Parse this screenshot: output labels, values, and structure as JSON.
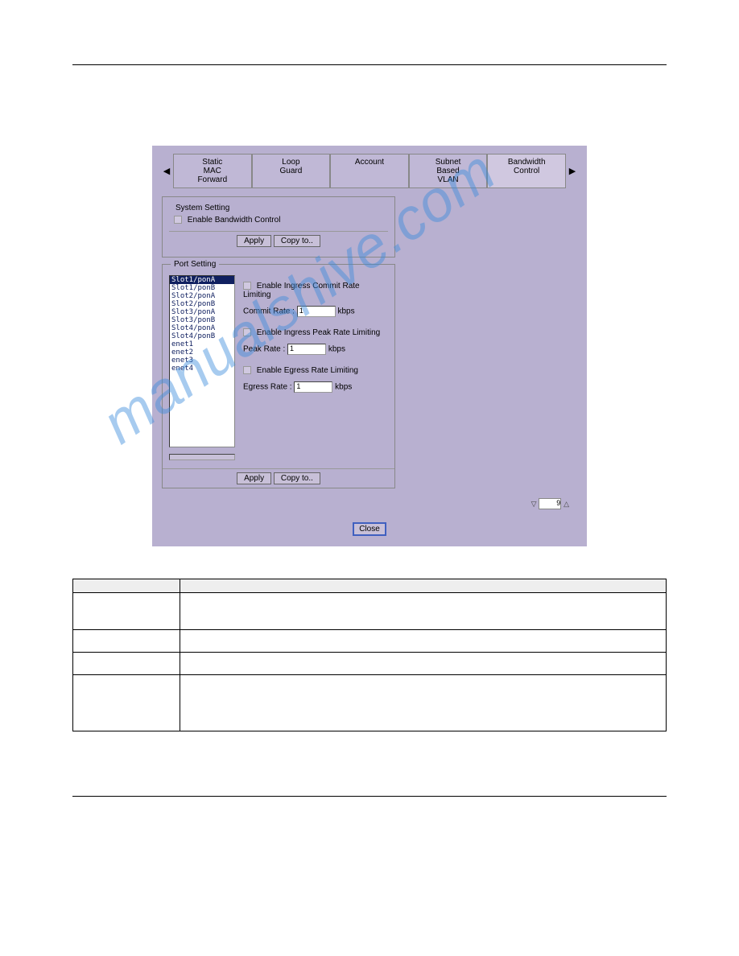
{
  "tabs": {
    "t1": "Static\nMAC\nForward",
    "t2": "Loop\nGuard",
    "t3": "Account",
    "t4": "Subnet\nBased\nVLAN",
    "t5": "Bandwidth\nControl"
  },
  "system": {
    "legend": "System Setting",
    "enable": "Enable Bandwidth Control",
    "apply": "Apply",
    "copy": "Copy to.."
  },
  "port": {
    "legend": "Port Setting",
    "items": {
      "i0": "Slot1/ponA",
      "i1": "Slot1/ponB",
      "i2": "Slot2/ponA",
      "i3": "Slot2/ponB",
      "i4": "Slot3/ponA",
      "i5": "Slot3/ponB",
      "i6": "Slot4/ponA",
      "i7": "Slot4/ponB",
      "i8": "enet1",
      "i9": "enet2",
      "i10": "enet3",
      "i11": "enet4"
    },
    "ingress_commit_chk": "Enable Ingress Commit Rate Limiting",
    "commit_label": "Commit Rate :",
    "commit_val": "1",
    "kbps": "kbps",
    "ingress_peak_chk": "Enable Ingress Peak Rate Limiting",
    "peak_label": "Peak Rate :",
    "peak_val": "1",
    "egress_chk": "Enable Egress Rate Limiting",
    "egress_label": "Egress Rate :",
    "egress_val": "1",
    "apply": "Apply",
    "copy": "Copy to.."
  },
  "bottom": {
    "page": "9",
    "close": "Close"
  },
  "watermark": "manualshive.com",
  "table": {
    "h1": "",
    "h2": ""
  }
}
